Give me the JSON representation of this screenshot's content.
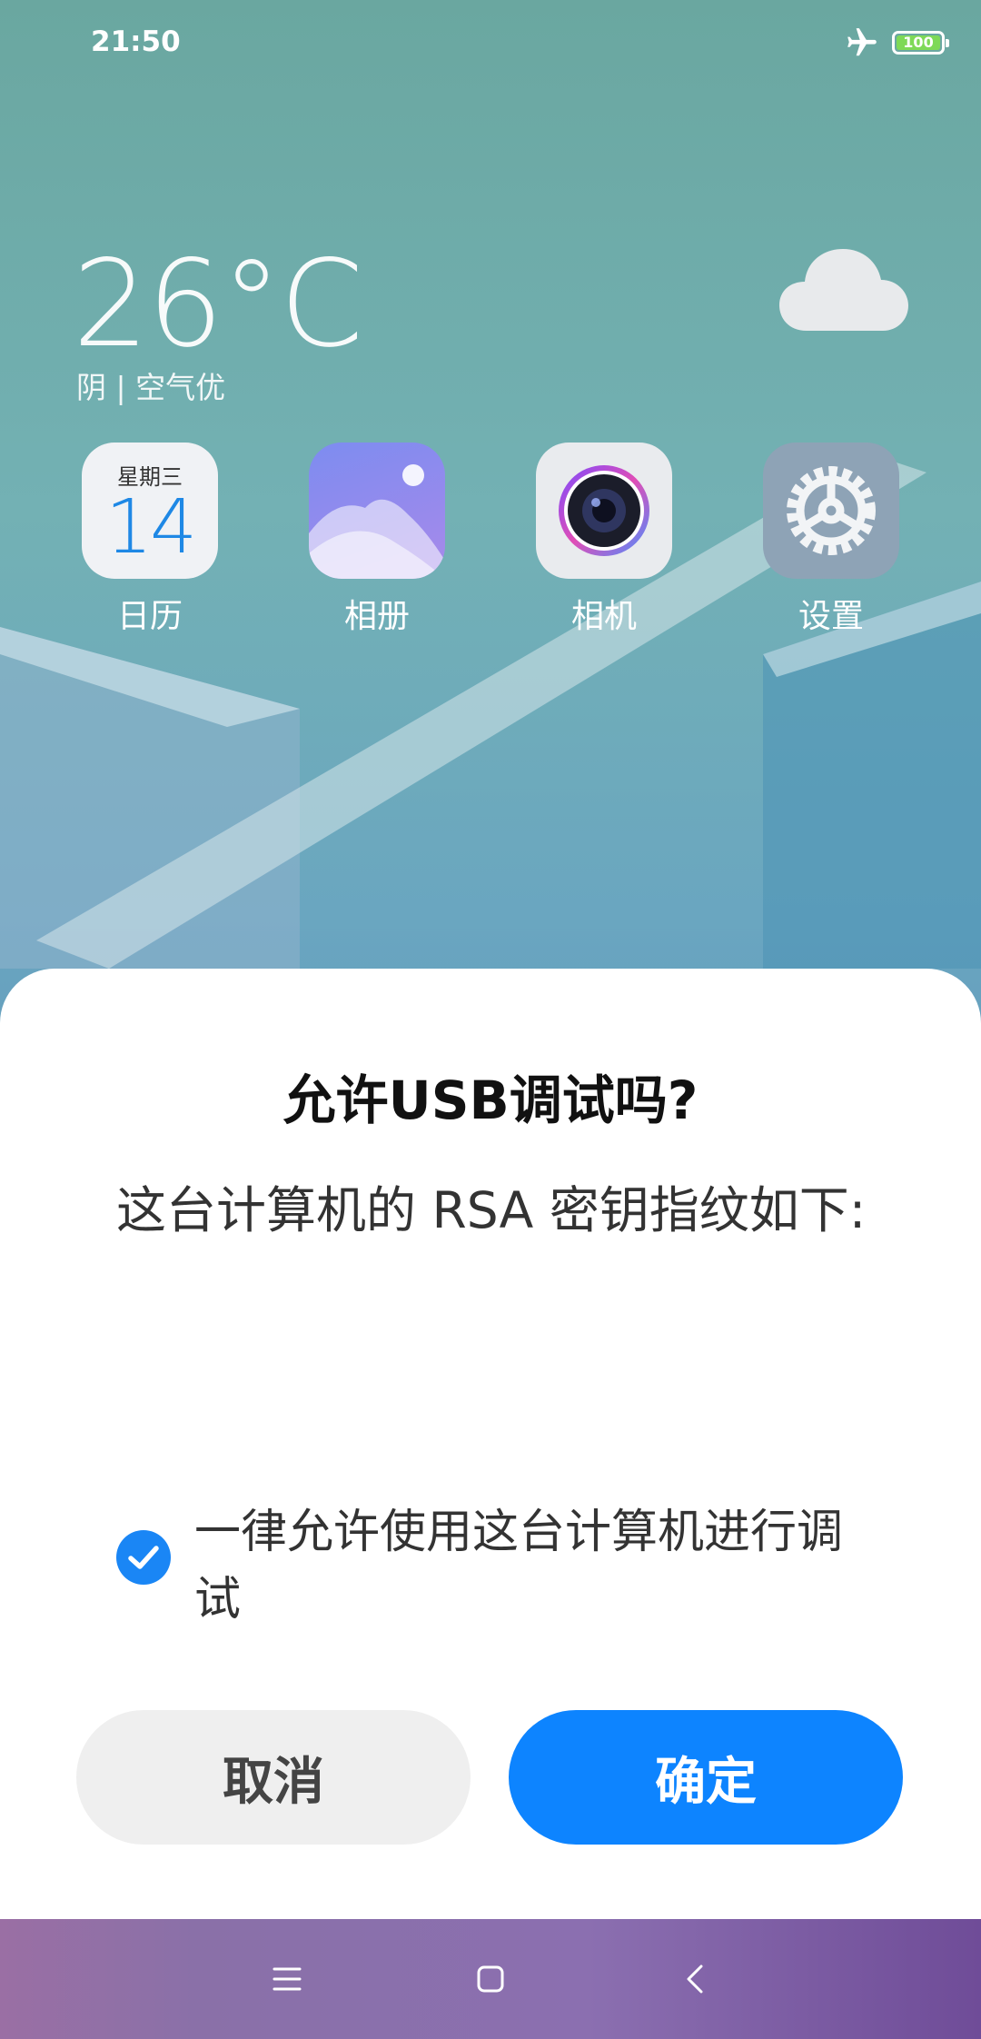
{
  "status_bar": {
    "time": "21:50",
    "battery": "100",
    "icons": [
      "airplane-mode-icon",
      "battery-icon"
    ]
  },
  "weather": {
    "temperature": "26°C",
    "description": "阴 | 空气优",
    "icon": "cloud-icon"
  },
  "apps": [
    {
      "label": "日历",
      "icon": "calendar-icon",
      "weekday": "星期三",
      "day": "14"
    },
    {
      "label": "相册",
      "icon": "gallery-icon"
    },
    {
      "label": "相机",
      "icon": "camera-icon"
    },
    {
      "label": "设置",
      "icon": "settings-icon"
    }
  ],
  "dialog": {
    "title": "允许USB调试吗?",
    "message": "这台计算机的 RSA 密钥指纹如下:",
    "checkbox_label": "一律允许使用这台计算机进行调试",
    "checkbox_checked": true,
    "cancel_label": "取消",
    "confirm_label": "确定"
  },
  "navigation": {
    "buttons": [
      "menu-icon",
      "home-icon",
      "back-icon"
    ]
  },
  "colors": {
    "accent": "#0d84ff",
    "cancel_bg": "#efefef"
  }
}
